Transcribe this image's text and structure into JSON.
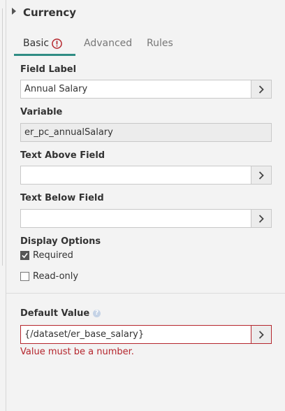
{
  "section": {
    "title": "Currency"
  },
  "tabs": {
    "basic": "Basic",
    "advanced": "Advanced",
    "rules": "Rules"
  },
  "fields": {
    "field_label": {
      "label": "Field Label",
      "value": "Annual Salary"
    },
    "variable": {
      "label": "Variable",
      "value": "er_pc_annualSalary"
    },
    "text_above": {
      "label": "Text Above Field",
      "value": ""
    },
    "text_below": {
      "label": "Text Below Field",
      "value": ""
    }
  },
  "display_options": {
    "label": "Display Options",
    "required": {
      "label": "Required",
      "checked": true
    },
    "read_only": {
      "label": "Read-only",
      "checked": false
    }
  },
  "default_value": {
    "label": "Default Value",
    "value": "{/dataset/er_base_salary}",
    "error": "Value must be a number."
  },
  "colors": {
    "accent": "#2f8c84",
    "error": "#b5262d",
    "help": "#c5d3e6"
  }
}
